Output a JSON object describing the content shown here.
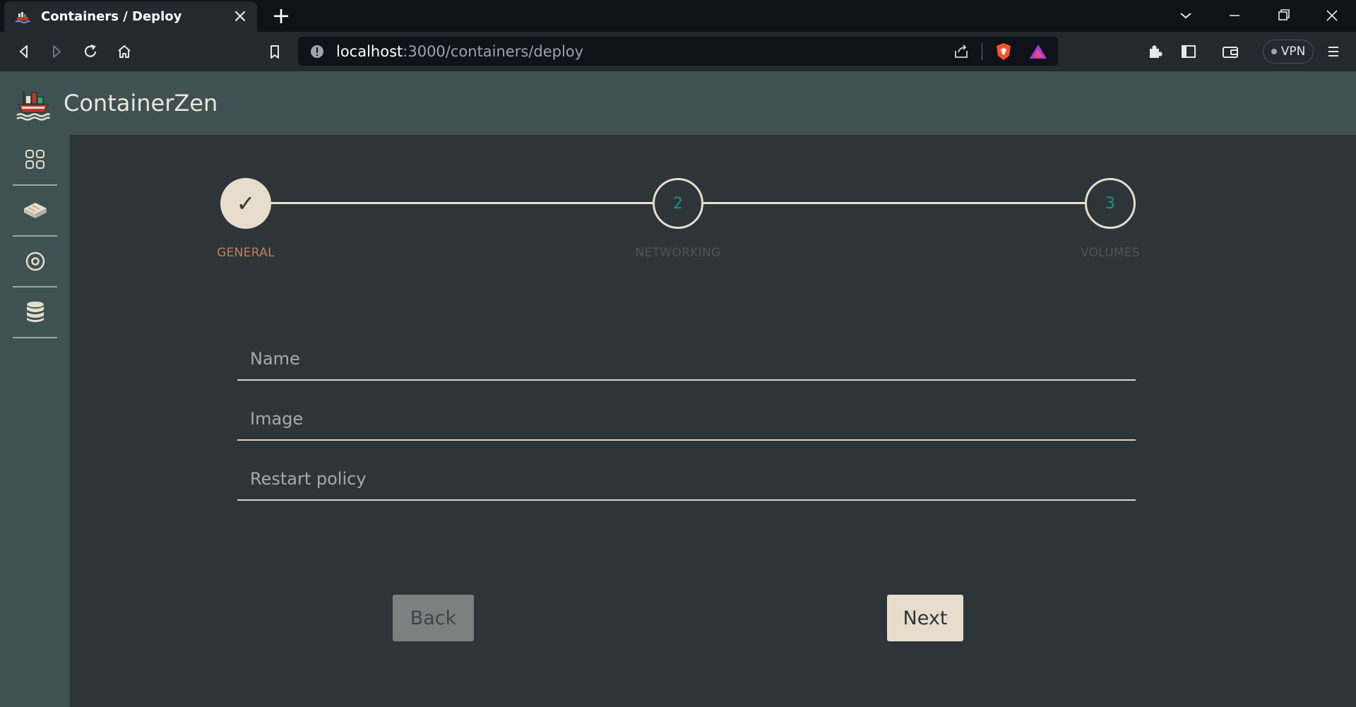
{
  "browser": {
    "tab_title": "Containers / Deploy",
    "url_host": "localhost",
    "url_path": ":3000/containers/deploy",
    "vpn_label": "VPN"
  },
  "app": {
    "title": "ContainerZen"
  },
  "sidebar": {
    "items": [
      {
        "icon": "dashboard-grid-icon"
      },
      {
        "icon": "container-box-icon"
      },
      {
        "icon": "disc-icon"
      },
      {
        "icon": "database-icon"
      }
    ]
  },
  "stepper": {
    "steps": [
      {
        "number": "✓",
        "label": "GENERAL",
        "state": "completed"
      },
      {
        "number": "2",
        "label": "NETWORKING",
        "state": "pending"
      },
      {
        "number": "3",
        "label": "VOLUMES",
        "state": "pending"
      }
    ]
  },
  "form": {
    "name_placeholder": "Name",
    "image_placeholder": "Image",
    "restart_policy_placeholder": "Restart policy"
  },
  "actions": {
    "back_label": "Back",
    "next_label": "Next"
  },
  "colors": {
    "accent_cream": "#e6ddcd",
    "active_step_label": "#c47f5a",
    "pending_step_number": "#1f8f86",
    "pending_step_label": "#4a5558",
    "header_bg": "#3f5152",
    "main_bg": "#2e3538"
  }
}
